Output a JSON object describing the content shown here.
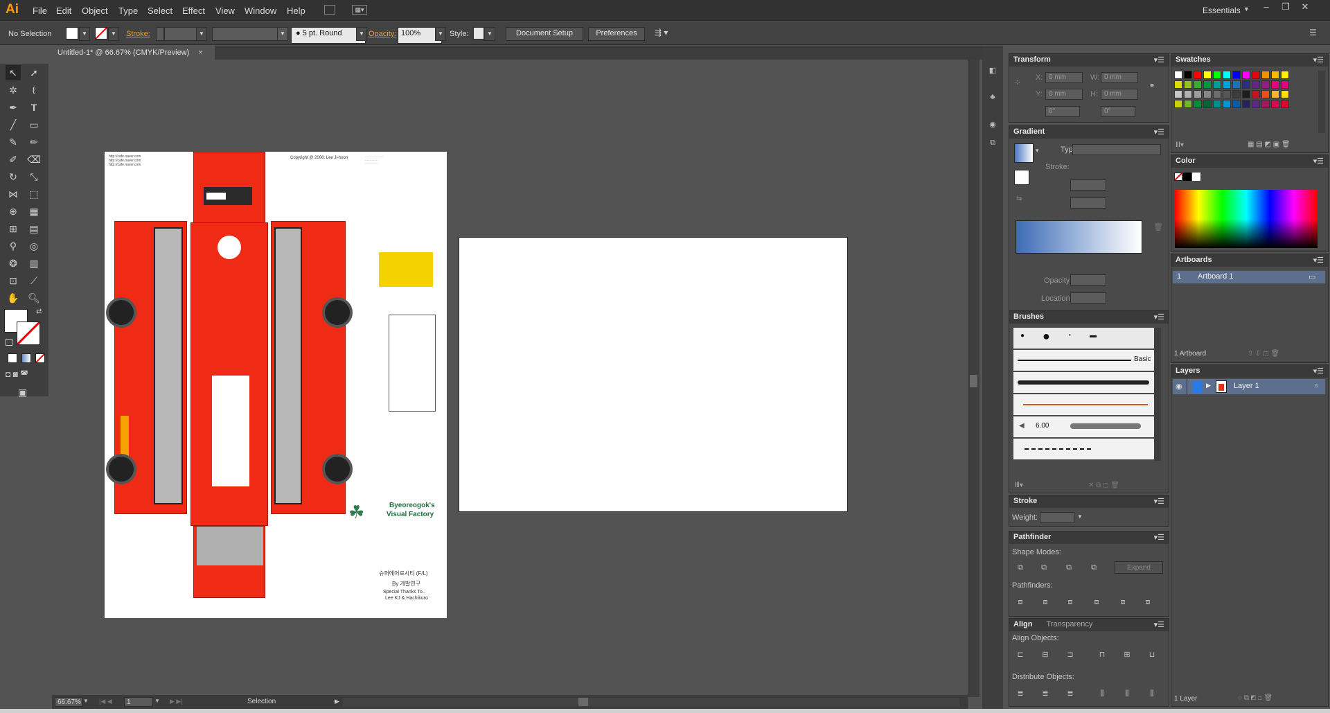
{
  "app": {
    "logo": "Ai",
    "workspace": "Essentials"
  },
  "menu": [
    "File",
    "Edit",
    "Object",
    "Type",
    "Select",
    "Effect",
    "View",
    "Window",
    "Help"
  ],
  "control": {
    "selection": "No Selection",
    "stroke_label": "Stroke:",
    "brush_size": "5 pt. Round",
    "opacity_label": "Opacity:",
    "opacity_value": "100%",
    "style_label": "Style:",
    "document_setup": "Document Setup",
    "preferences": "Preferences"
  },
  "document": {
    "tab_title": "Untitled-1* @ 66.67% (CMYK/Preview)",
    "close": "×"
  },
  "artboard_content": {
    "copyright": "Copyright @ 2008. Lee Ji-hoon",
    "watermark_title": "Byeoreogok's",
    "watermark_sub": "Visual Factory",
    "korean_title": "슈퍼에어로시티 (F/L)",
    "by": "By 개발연구",
    "thanks": "Special Thanks To..",
    "thanks_names": "Lee KJ & Hachikuro"
  },
  "status": {
    "zoom": "66.67%",
    "artboard": "1",
    "tool": "Selection"
  },
  "transform": {
    "title": "Transform",
    "x_label": "X:",
    "x": "0 mm",
    "w_label": "W:",
    "w": "0 mm",
    "y_label": "Y:",
    "y": "0 mm",
    "h_label": "H:",
    "h": "0 mm",
    "angle": "0°",
    "shear": "0°"
  },
  "gradient": {
    "title": "Gradient",
    "type_label": "Type:",
    "stroke_label": "Stroke:",
    "opacity_label": "Opacity:",
    "location_label": "Location:"
  },
  "brushes": {
    "title": "Brushes",
    "basic": "Basic",
    "size": "6.00"
  },
  "stroke": {
    "title": "Stroke",
    "weight_label": "Weight:"
  },
  "pathfinder": {
    "title": "Pathfinder",
    "shape_modes": "Shape Modes:",
    "expand": "Expand",
    "pathfinders": "Pathfinders:"
  },
  "align": {
    "title": "Align",
    "tab2": "Transparency",
    "align_objects": "Align Objects:",
    "distribute_objects": "Distribute Objects:"
  },
  "swatches": {
    "title": "Swatches",
    "colors": [
      "#ffffff",
      "#000000",
      "#ff0000",
      "#ffff00",
      "#00ff00",
      "#00ffff",
      "#0000ff",
      "#ff00ff",
      "#e20613",
      "#f39200",
      "#fabb00",
      "#fff000",
      "#dedc00",
      "#95c11f",
      "#3aaa35",
      "#00963f",
      "#009e92",
      "#009fe3",
      "#1d71b8",
      "#2d2e83",
      "#662483",
      "#951b81",
      "#e6007e",
      "#e5007e",
      "#c6c6c6",
      "#b2b2b2",
      "#9d9d9d",
      "#878787",
      "#706f6f",
      "#575756",
      "#3c3c3b",
      "#1d1d1b",
      "#be1622",
      "#e94e1b",
      "#f9b233",
      "#ffde00",
      "#c8d400",
      "#6fb72f",
      "#008d36",
      "#006633",
      "#008e90",
      "#0096cf",
      "#005ca9",
      "#29235c",
      "#5b2a84",
      "#a3195b",
      "#d60b52",
      "#e4032e"
    ]
  },
  "color": {
    "title": "Color"
  },
  "artboards": {
    "title": "Artboards",
    "row_index": "1",
    "row_name": "Artboard 1",
    "count": "1 Artboard"
  },
  "layers": {
    "title": "Layers",
    "layer_name": "Layer 1",
    "count": "1 Layer"
  }
}
